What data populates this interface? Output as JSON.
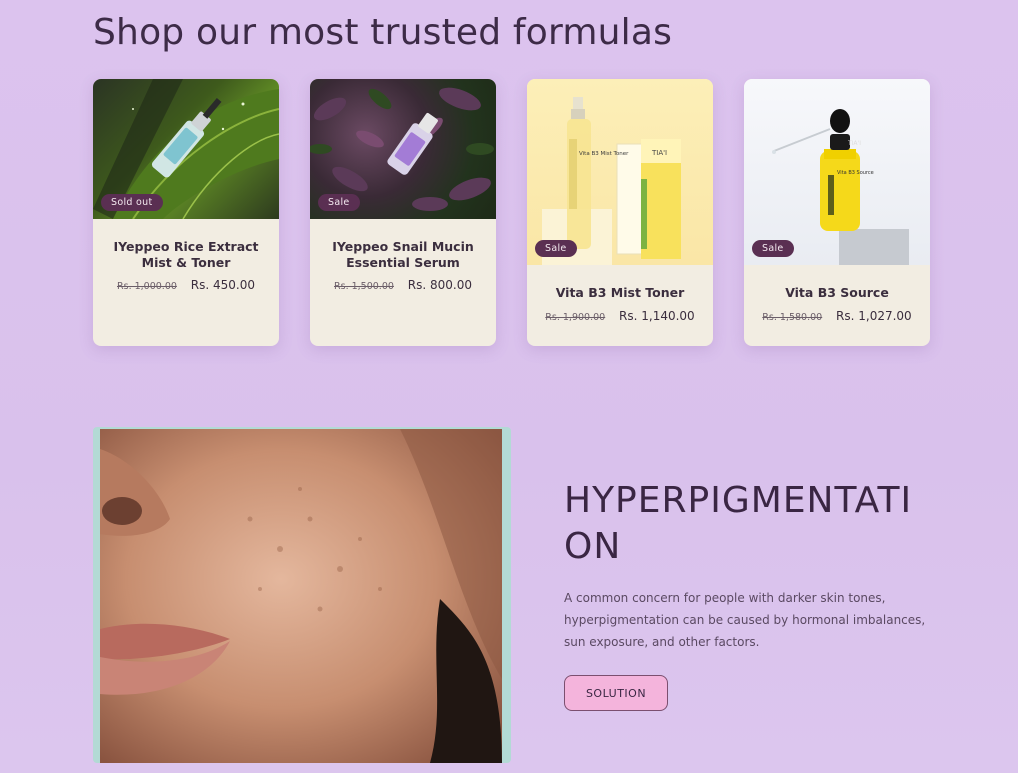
{
  "section": {
    "title": "Shop our most trusted formulas"
  },
  "products": [
    {
      "name": "IYeppeo Rice Extract Mist & Toner",
      "old_price": "Rs. 1,000.00",
      "price": "Rs. 450.00",
      "badge": "Sold out"
    },
    {
      "name": "IYeppeo Snail Mucin Essential Serum",
      "old_price": "Rs. 1,500.00",
      "price": "Rs. 800.00",
      "badge": "Sale"
    },
    {
      "name": "Vita B3 Mist Toner",
      "old_price": "Rs. 1,900.00",
      "price": "Rs. 1,140.00",
      "badge": "Sale",
      "brand_label": "TIA'I",
      "box_text": "Vita B3 Mist Toner"
    },
    {
      "name": "Vita B3 Source",
      "old_price": "Rs. 1,580.00",
      "price": "Rs. 1,027.00",
      "badge": "Sale",
      "brand_label": "TIA'I",
      "bottle_text": "Vita B3 Source"
    }
  ],
  "feature": {
    "title": "HYPERPIGMENTATI ON",
    "title_line1": "HYPERPIGMENTATI",
    "title_line2": "ON",
    "description": "A common concern for people with darker skin tones, hyperpigmentation can be caused by hormonal imbalances, sun exposure, and other factors.",
    "button_label": "SOLUTION"
  },
  "colors": {
    "background": "#dcc3ee",
    "badge": "#5a2f52",
    "button": "#f4b4dc",
    "card": "#f2ede2",
    "image_frame": "#b3dad5"
  }
}
